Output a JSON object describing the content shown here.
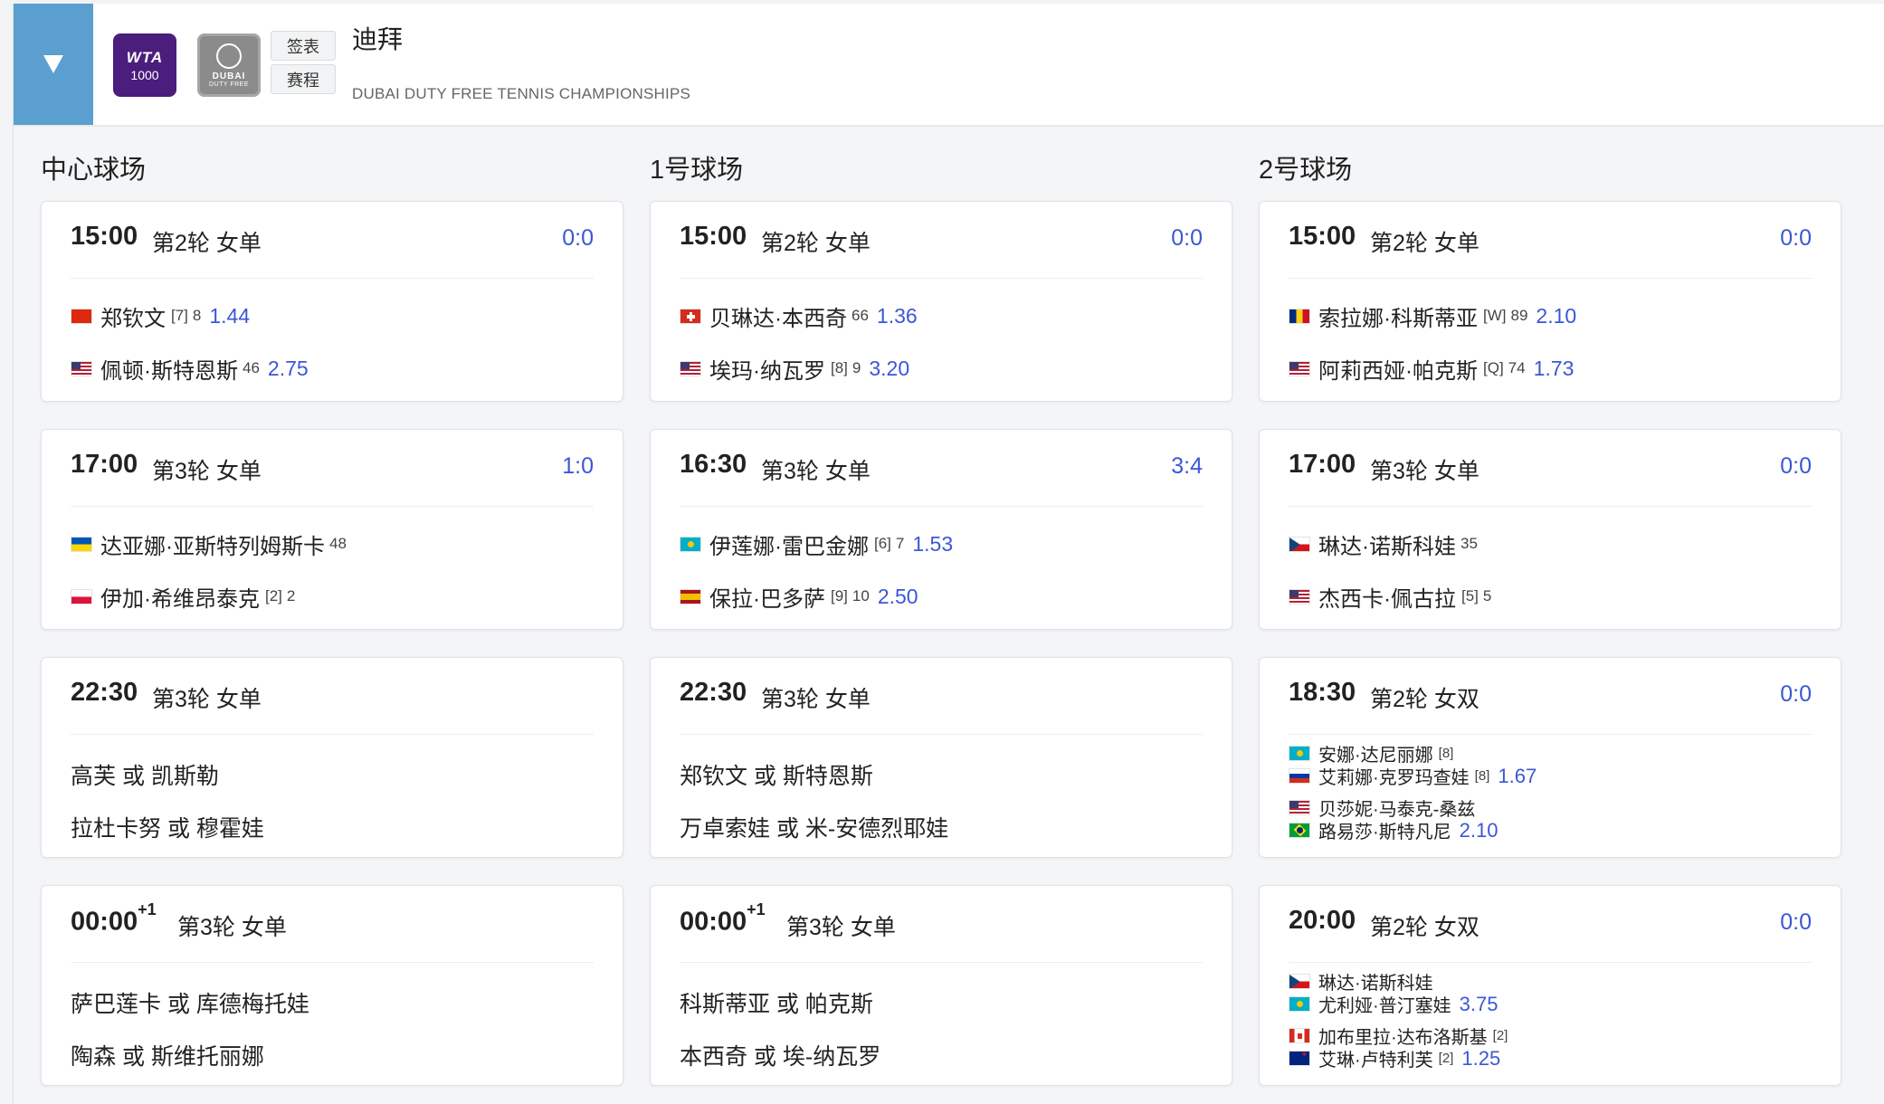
{
  "header": {
    "wta_logo": {
      "line1": "WTA",
      "line2": "1000"
    },
    "dubai_logo": {
      "line1": "DUBAI",
      "line2": "DUTY FREE"
    },
    "btn_draw": "签表",
    "btn_schedule": "赛程",
    "title": "迪拜",
    "subtitle": "DUBAI DUTY FREE TENNIS CHAMPIONSHIPS"
  },
  "courts": [
    {
      "name": "中心球场",
      "matches": [
        {
          "time": "15:00",
          "round": "第2轮 女单",
          "score": "0:0",
          "p1": {
            "flag": "cn",
            "name": "郑钦文",
            "seed": "[7]",
            "rank": "8",
            "odds": "1.44"
          },
          "p2": {
            "flag": "us",
            "name": "佩顿·斯特恩斯",
            "seed": "",
            "rank": "46",
            "odds": "2.75"
          }
        },
        {
          "time": "17:00",
          "round": "第3轮 女单",
          "score": "1:0",
          "p1": {
            "flag": "ua",
            "name": "达亚娜·亚斯特列姆斯卡",
            "seed": "",
            "rank": "48",
            "odds": ""
          },
          "p2": {
            "flag": "pl",
            "name": "伊加·希维昂泰克",
            "seed": "[2]",
            "rank": "2",
            "odds": ""
          }
        },
        {
          "time": "22:30",
          "round": "第3轮 女单",
          "line1": "高芙 或 凯斯勒",
          "line2": "拉杜卡努 或 穆霍娃"
        },
        {
          "time": "00:00",
          "time_sup": "+1",
          "round": "第3轮 女单",
          "line1": "萨巴莲卡 或 库德梅托娃",
          "line2": "陶森 或 斯维托丽娜"
        }
      ]
    },
    {
      "name": "1号球场",
      "matches": [
        {
          "time": "15:00",
          "round": "第2轮 女单",
          "score": "0:0",
          "p1": {
            "flag": "ch",
            "name": "贝琳达·本西奇",
            "seed": "",
            "rank": "66",
            "odds": "1.36"
          },
          "p2": {
            "flag": "us",
            "name": "埃玛·纳瓦罗",
            "seed": "[8]",
            "rank": "9",
            "odds": "3.20"
          }
        },
        {
          "time": "16:30",
          "round": "第3轮 女单",
          "score": "3:4",
          "p1": {
            "flag": "kz",
            "name": "伊莲娜·雷巴金娜",
            "seed": "[6]",
            "rank": "7",
            "odds": "1.53"
          },
          "p2": {
            "flag": "es",
            "name": "保拉·巴多萨",
            "seed": "[9]",
            "rank": "10",
            "odds": "2.50"
          }
        },
        {
          "time": "22:30",
          "round": "第3轮 女单",
          "line1": "郑钦文 或 斯特恩斯",
          "line2": "万卓索娃 或 米-安德烈耶娃"
        },
        {
          "time": "00:00",
          "time_sup": "+1",
          "round": "第3轮 女单",
          "line1": "科斯蒂亚 或 帕克斯",
          "line2": "本西奇 或 埃-纳瓦罗"
        }
      ]
    },
    {
      "name": "2号球场",
      "matches": [
        {
          "time": "15:00",
          "round": "第2轮 女单",
          "score": "0:0",
          "p1": {
            "flag": "ro",
            "name": "索拉娜·科斯蒂亚",
            "seed": "[W]",
            "rank": "89",
            "odds": "2.10"
          },
          "p2": {
            "flag": "us",
            "name": "阿莉西娅·帕克斯",
            "seed": "[Q]",
            "rank": "74",
            "odds": "1.73"
          }
        },
        {
          "time": "17:00",
          "round": "第3轮 女单",
          "score": "0:0",
          "p1": {
            "flag": "cz",
            "name": "琳达·诺斯科娃",
            "seed": "",
            "rank": "35",
            "odds": ""
          },
          "p2": {
            "flag": "us",
            "name": "杰西卡·佩古拉",
            "seed": "[5]",
            "rank": "5",
            "odds": ""
          }
        },
        {
          "time": "18:30",
          "round": "第2轮 女双",
          "score": "0:0",
          "team1": {
            "a": {
              "flag": "kz",
              "name": "安娜·达尼丽娜",
              "seed": "[8]"
            },
            "b": {
              "flag": "ru",
              "name": "艾莉娜·克罗玛查娃",
              "seed": "[8]"
            },
            "odds": "1.67"
          },
          "team2": {
            "a": {
              "flag": "us",
              "name": "贝莎妮·马泰克-桑兹",
              "seed": ""
            },
            "b": {
              "flag": "br",
              "name": "路易莎·斯特凡尼",
              "seed": ""
            },
            "odds": "2.10"
          }
        },
        {
          "time": "20:00",
          "round": "第2轮 女双",
          "score": "0:0",
          "team1": {
            "a": {
              "flag": "cz",
              "name": "琳达·诺斯科娃",
              "seed": ""
            },
            "b": {
              "flag": "kz",
              "name": "尤利娅·普汀塞娃",
              "seed": ""
            },
            "odds": "3.75"
          },
          "team2": {
            "a": {
              "flag": "ca",
              "name": "加布里拉·达布洛斯基",
              "seed": "[2]"
            },
            "b": {
              "flag": "nz",
              "name": "艾琳·卢特利芙",
              "seed": "[2]"
            },
            "odds": "1.25"
          }
        }
      ]
    }
  ]
}
